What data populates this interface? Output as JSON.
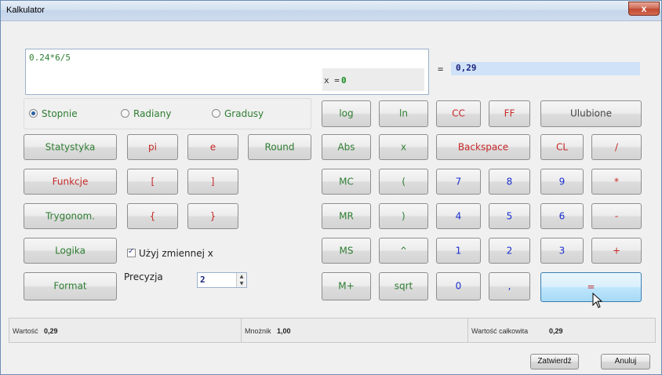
{
  "window": {
    "title": "Kalkulator",
    "close_label": "x"
  },
  "display": {
    "expression": "0.24*6/5",
    "x_label": "x = ",
    "x_value": "0",
    "equals": "=",
    "result": "0,29"
  },
  "angle_modes": {
    "selected": "Stopnie",
    "options": [
      "Stopnie",
      "Radiany",
      "Gradusy"
    ]
  },
  "left_buttons": {
    "statystyka": "Statystyka",
    "pi": "pi",
    "e": "e",
    "round": "Round",
    "funkcje": "Funkcje",
    "bracket_open": "[",
    "bracket_close": "]",
    "trygonom": "Trygonom.",
    "brace_open": "{",
    "brace_close": "}",
    "logika": "Logika",
    "format": "Format"
  },
  "use_variable": {
    "label": "Użyj zmiennej x",
    "checked": true
  },
  "precision": {
    "label": "Precyzja",
    "value": "2"
  },
  "right_buttons": {
    "log": "log",
    "ln": "ln",
    "cc": "CC",
    "ff": "FF",
    "ulubione": "Ulubione",
    "abs": "Abs",
    "x": "x",
    "backspace": "Backspace",
    "cl": "CL",
    "divide": "/",
    "mc": "MC",
    "paren_open": "(",
    "seven": "7",
    "eight": "8",
    "nine": "9",
    "multiply": "*",
    "mr": "MR",
    "paren_close": ")",
    "four": "4",
    "five": "5",
    "six": "6",
    "minus": "-",
    "ms": "MS",
    "power": "^",
    "one": "1",
    "two": "2",
    "three": "3",
    "plus": "+",
    "mplus": "M+",
    "sqrt": "sqrt",
    "zero": "0",
    "comma": ",",
    "equals": "="
  },
  "status": {
    "wartosc_label": "Wartość",
    "wartosc_value": "0,29",
    "mnoznik_label": "Mnożnik",
    "mnoznik_value": "1,00",
    "calkowita_label": "Wartość całkowita",
    "calkowita_value": "0,29"
  },
  "footer": {
    "confirm": "Zatwierdź",
    "cancel": "Anuluj"
  },
  "colors": {
    "green_text": "#2e7d32",
    "red_text": "#c62828",
    "blue_digits": "#1a2fd0",
    "result_bg": "#cfe2f7",
    "equals_button": "#bee6fd"
  }
}
